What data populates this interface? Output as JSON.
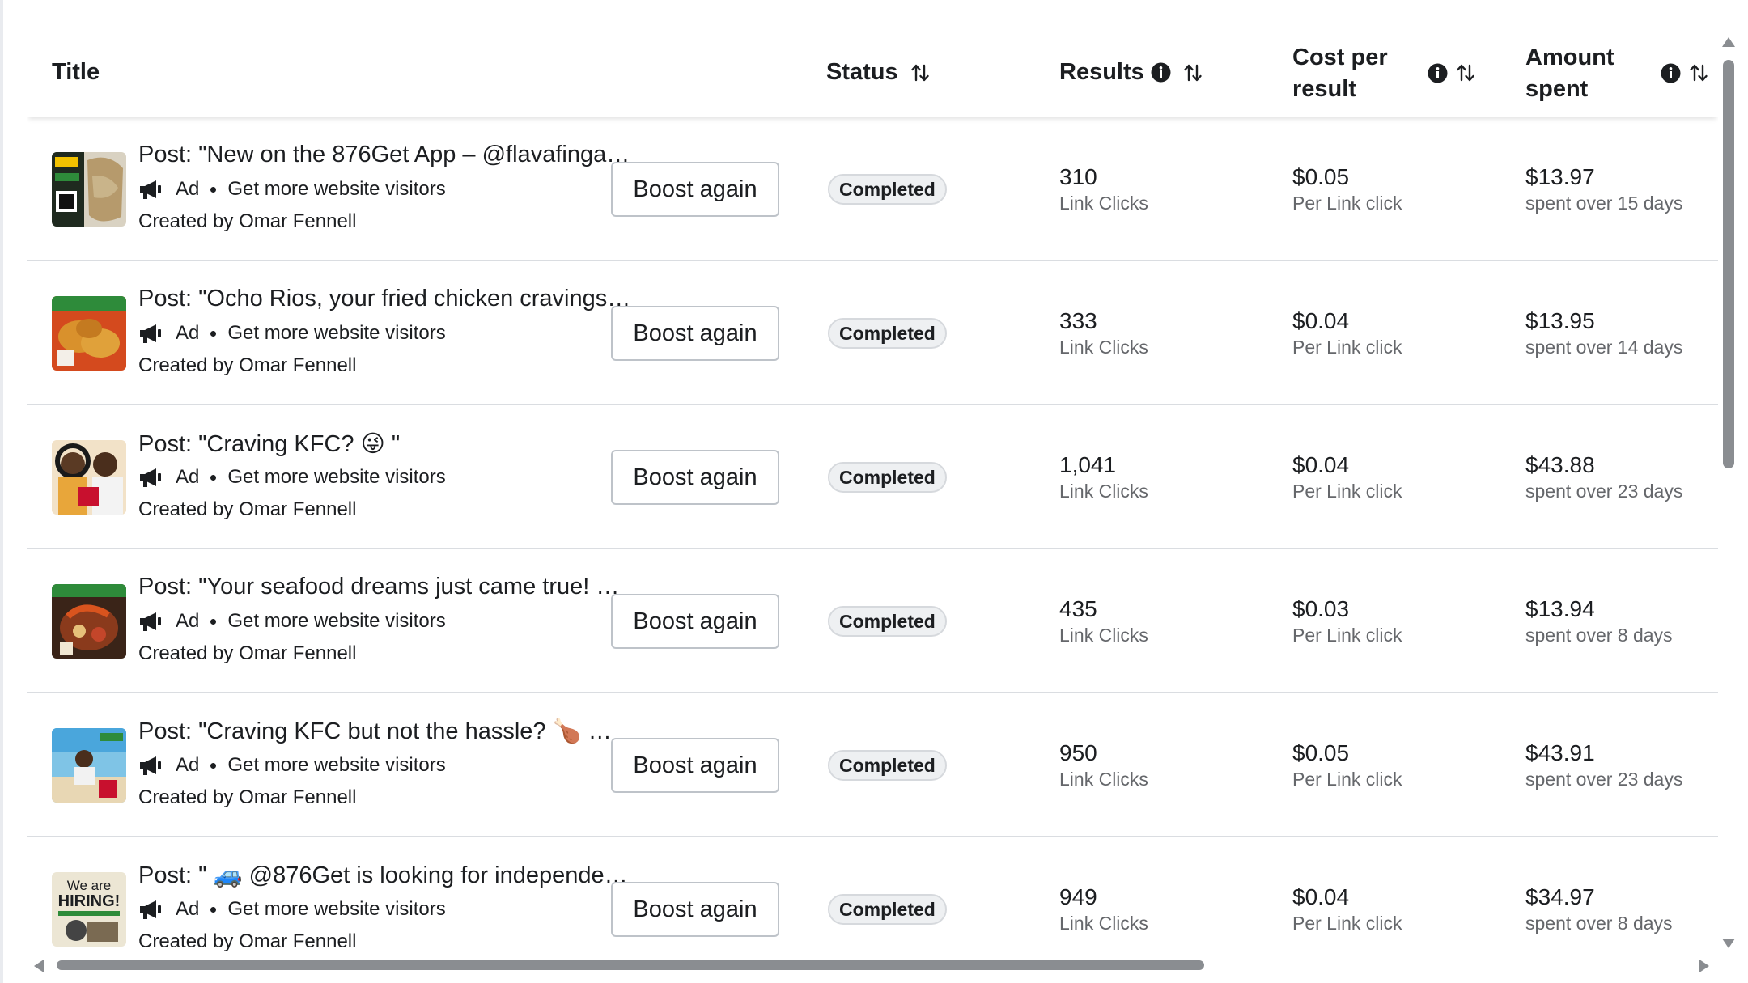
{
  "header": {
    "title": "Title",
    "status": "Status",
    "results": "Results",
    "cost_line1": "Cost per",
    "cost_line2": "result",
    "amount_line1": "Amount",
    "amount_line2": "spent"
  },
  "boost_label": "Boost again",
  "status_label": "Completed",
  "ad_label": "Ad",
  "objective": "Get more website visitors",
  "creator": "Created by Omar Fennell",
  "rows": [
    {
      "title": "Post: \"New on the 876Get App – @flavafinga…",
      "results": "310",
      "results_sub": "Link Clicks",
      "cost": "$0.05",
      "cost_sub": "Per Link click",
      "amount": "$13.97",
      "amount_sub": "spent over 15 days"
    },
    {
      "title": "Post: \"Ocho Rios, your fried chicken cravings…",
      "results": "333",
      "results_sub": "Link Clicks",
      "cost": "$0.04",
      "cost_sub": "Per Link click",
      "amount": "$13.95",
      "amount_sub": "spent over 14 days"
    },
    {
      "title": "Post: \"Craving KFC? 😜 \"",
      "results": "1,041",
      "results_sub": "Link Clicks",
      "cost": "$0.04",
      "cost_sub": "Per Link click",
      "amount": "$43.88",
      "amount_sub": "spent over 23 days"
    },
    {
      "title": "Post: \"Your seafood dreams just came true! …",
      "results": "435",
      "results_sub": "Link Clicks",
      "cost": "$0.03",
      "cost_sub": "Per Link click",
      "amount": "$13.94",
      "amount_sub": "spent over 8 days"
    },
    {
      "title": "Post: \"Craving KFC but not the hassle? 🍗 ✨ \"",
      "results": "950",
      "results_sub": "Link Clicks",
      "cost": "$0.05",
      "cost_sub": "Per Link click",
      "amount": "$43.91",
      "amount_sub": "spent over 23 days"
    },
    {
      "title": "Post: \" 🚙 @876Get is looking for independe…",
      "results": "949",
      "results_sub": "Link Clicks",
      "cost": "$0.04",
      "cost_sub": "Per Link click",
      "amount": "$34.97",
      "amount_sub": "spent over 8 days"
    }
  ],
  "thumb_texts": {
    "hiring_line1": "We are",
    "hiring_line2": "HIRING!"
  },
  "colors": {
    "text": "#1c1e21",
    "secondary": "#65676b",
    "divider": "#dadde1",
    "badge_bg": "#eef0f2"
  }
}
